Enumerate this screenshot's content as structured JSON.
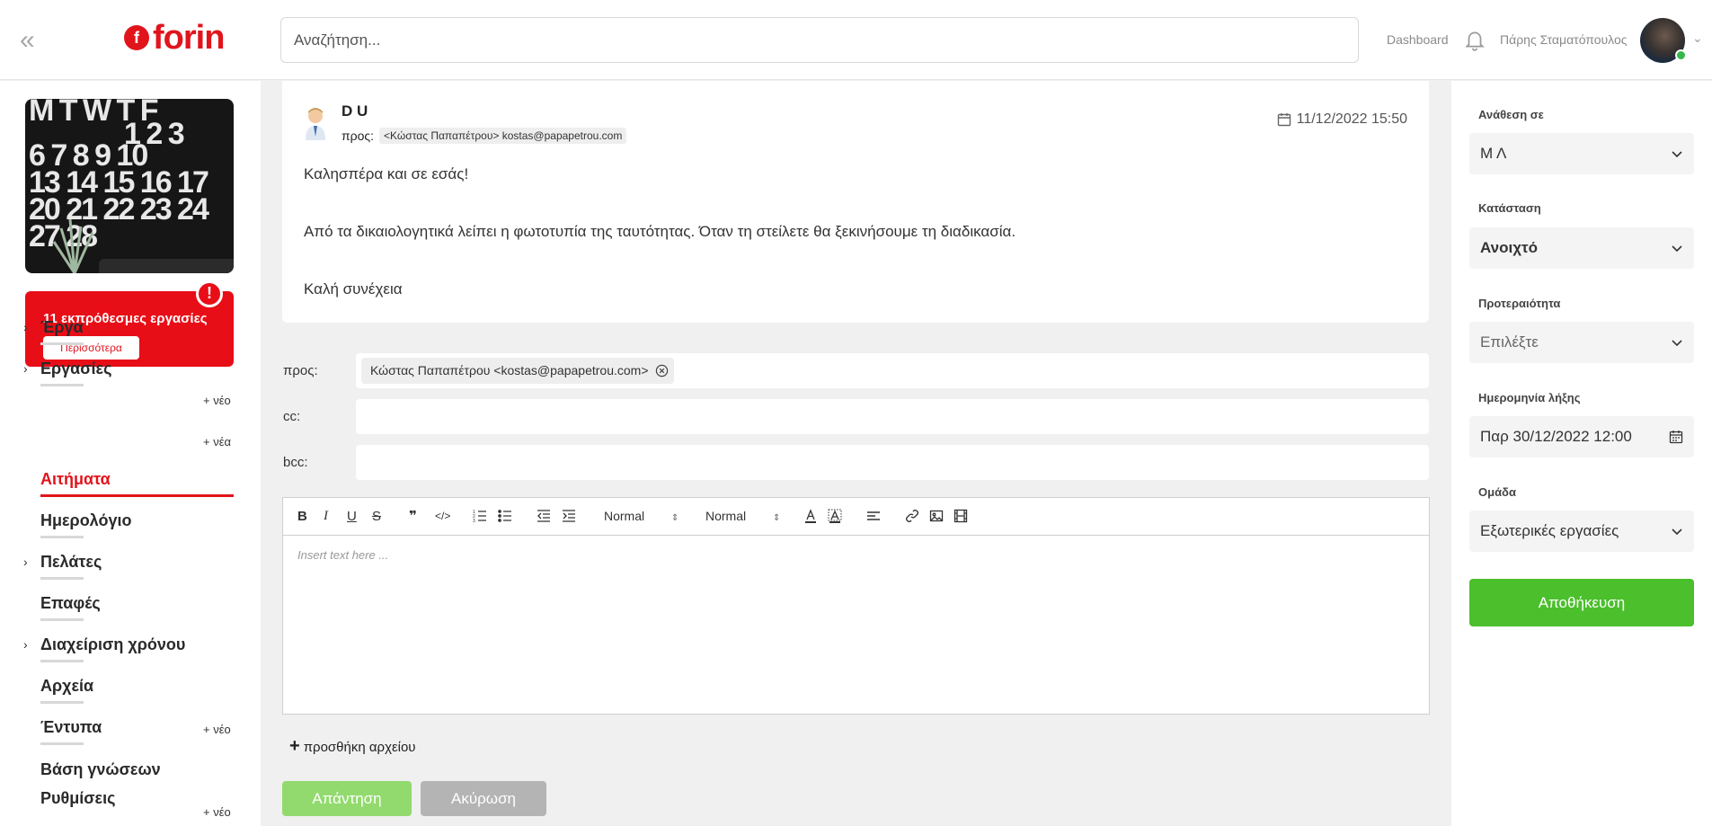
{
  "header": {
    "collapse_icon": "double-chevron-left-icon",
    "logo_text": "forin",
    "search_placeholder": "Αναζήτηση...",
    "dashboard_label": "Dashboard",
    "user_name": "Πάρης Σταματόπουλος",
    "status_color": "#35b849"
  },
  "sidebar": {
    "calendar_rows": [
      "M T W T F",
      "         1 2 3",
      "6 7 8 9 10",
      "13 14 15 16 17",
      "20 21 22 23 24",
      "27 28"
    ],
    "overdue_text": "11 εκπρόθεσμες εργασίες",
    "overdue_more": "Περισσότερα",
    "overdue_alert": "!",
    "items": [
      {
        "label": "Έργα",
        "new": "+ νέο"
      },
      {
        "label": "Εργασίες",
        "new": "+ νέα"
      },
      {
        "label": "Αιτήματα"
      },
      {
        "label": "Ημερολόγιο"
      },
      {
        "label": "Πελάτες"
      },
      {
        "label": "Επαφές"
      },
      {
        "label": "Διαχείριση χρόνου",
        "new": "+ νέο"
      },
      {
        "label": "Αρχεία"
      },
      {
        "label": "Έντυπα",
        "new": "+ νέο"
      },
      {
        "label": "Βάση γνώσεων"
      },
      {
        "label": "Ρυθμίσεις"
      }
    ],
    "accent_color": "#e1141c"
  },
  "email": {
    "sender": "D U",
    "to_label": "προς:",
    "to_value": "<Κώστας Παπαπέτρου> kostas@papapetrou.com",
    "date": "11/12/2022 15:50",
    "body": [
      "Καλησπέρα και σε εσάς!",
      "Από τα δικαιολογητικά λείπει η φωτοτυπία της ταυτότητας. Όταν τη στείλετε θα ξεκινήσουμε τη διαδικασία.",
      "Καλή συνέχεια"
    ]
  },
  "reply": {
    "to_label": "προς:",
    "to_chip": "Κώστας Παπαπέτρου <kostas@papapetrou.com>",
    "cc_label": "cc:",
    "bcc_label": "bcc:",
    "toolbar": {
      "bold": "B",
      "italic": "I",
      "underline": "U",
      "strike": "S",
      "quote": "❞",
      "code": "</>",
      "heading_select": "Normal",
      "size_select": "Normal"
    },
    "editor_placeholder": "Insert text here ...",
    "attach_label": "προσθήκη αρχείου",
    "reply_button": "Απάντηση",
    "cancel_button": "Ακύρωση"
  },
  "right_panel": {
    "assign_label": "Ανάθεση σε",
    "assign_value": "Μ Λ",
    "status_label": "Κατάσταση",
    "status_value": "Ανοιχτό",
    "priority_label": "Προτεραιότητα",
    "priority_value": "Επιλέξτε",
    "due_label": "Ημερομηνία λήξης",
    "due_value": "Παρ 30/12/2022 12:00",
    "group_label": "Ομάδα",
    "group_value": "Εξωτερικές εργασίες",
    "save_button": "Αποθήκευση",
    "save_color": "#4bbf2c"
  }
}
